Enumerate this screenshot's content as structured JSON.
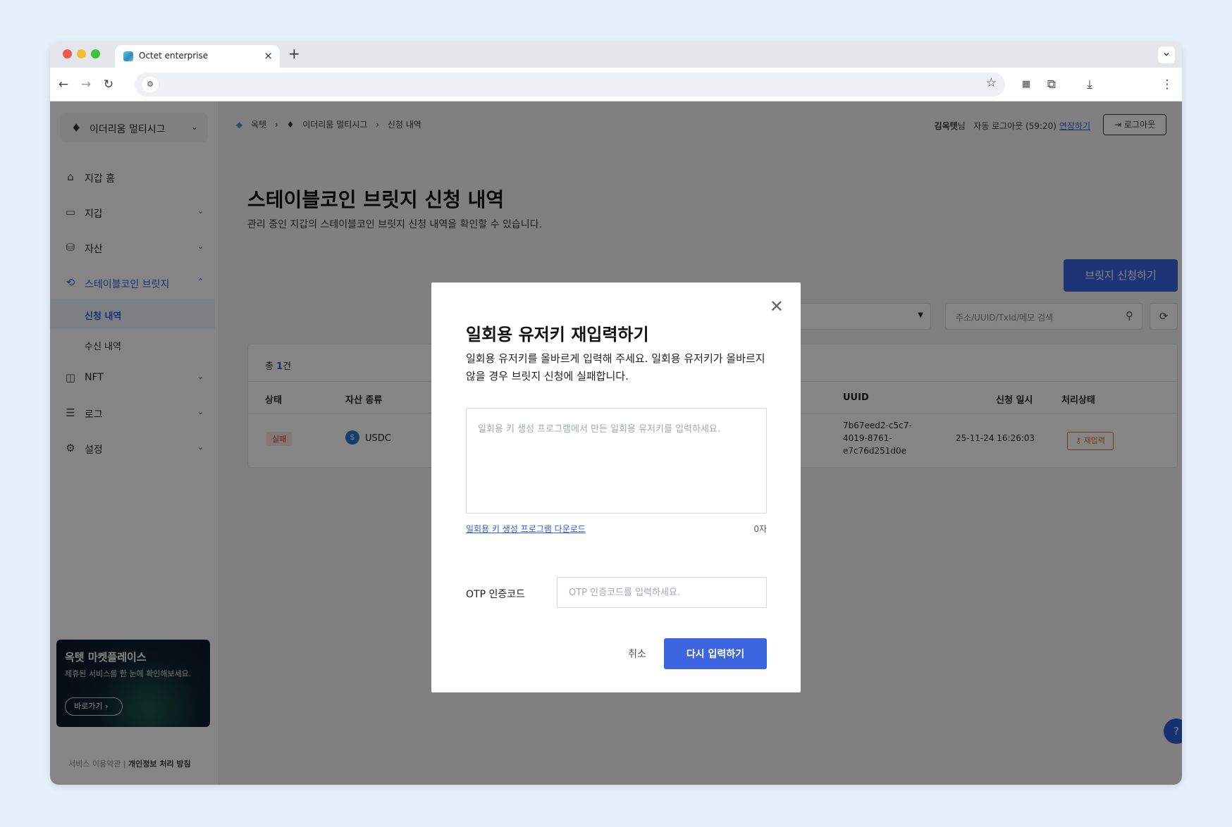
{
  "browser": {
    "tab_title": "Octet enterprise",
    "tab_close": "×",
    "new_tab": "+",
    "menu_chevron": "⌄"
  },
  "sidebar": {
    "wallet_name": "이더리움 멀티시그",
    "items": [
      {
        "label": "지갑 홈",
        "icon": "home-icon"
      },
      {
        "label": "지갑",
        "icon": "wallet-icon"
      },
      {
        "label": "자산",
        "icon": "asset-icon"
      },
      {
        "label": "스테이블코인 브릿지",
        "icon": "bridge-icon"
      },
      {
        "label": "NFT",
        "icon": "nft-icon"
      },
      {
        "label": "로그",
        "icon": "log-icon"
      },
      {
        "label": "설정",
        "icon": "settings-icon"
      }
    ],
    "sub_items": [
      {
        "label": "신청 내역"
      },
      {
        "label": "수신 내역"
      }
    ],
    "promo": {
      "title": "옥텟 마켓플레이스",
      "desc": "제휴된 서비스를 한 눈에 확인해보세요.",
      "button": "바로가기"
    },
    "footer": {
      "terms": "서비스 이용약관",
      "privacy": "개인정보 처리 방침"
    }
  },
  "header": {
    "breadcrumb": [
      "옥텟",
      "이더리움 멀티시그",
      "신청 내역"
    ],
    "user_name": "김옥텟",
    "user_suffix": "님",
    "auto_logout": "자동 로그아웃 (59:20)",
    "extend": "연장하기",
    "logout": "로그아웃"
  },
  "page": {
    "title": "스테이블코인 브릿지 신청 내역",
    "description": "관리 중인 지갑의 스테이블코인 브릿지 신청 내역을 확인할 수 있습니다.",
    "apply_button": "브릿지 신청하기",
    "search_placeholder": "주소/UUID/TxId/메모 검색",
    "total_prefix": "총 ",
    "total_count": "1",
    "total_suffix": "건"
  },
  "table": {
    "columns": [
      "상태",
      "자산 종류",
      "UUID",
      "신청 일시",
      "처리상태"
    ],
    "rows": [
      {
        "status": "실패",
        "asset": "USDC",
        "uuid_line1": "7b67eed2-c5c7-",
        "uuid_line2": "4019-8761-",
        "uuid_line3": "e7c76d251d0e",
        "date": "25-11-24 16:26:03",
        "action": "재입력"
      }
    ]
  },
  "modal": {
    "title": "일회용 유저키 재입력하기",
    "description": "일회용 유저키를 올바르게 입력해 주세요. 일회용 유저키가 올바르지 않을 경우 브릿지 신청에 실패합니다.",
    "textarea_placeholder": "일회용 키 생성 프로그램에서 만든 일회용 유저키를 입력하세요.",
    "download_link": "일회용 키 생성 프로그램 다운로드",
    "char_count": "0자",
    "otp_label": "OTP 인증코드",
    "otp_placeholder": "OTP 인증코드를 입력하세요.",
    "cancel": "취소",
    "confirm": "다시 입력하기"
  },
  "help": "?",
  "colors": {
    "primary": "#3b66e0",
    "fail": "#d73a3a",
    "action": "#e46b2a",
    "background": "#e6f0fb"
  }
}
